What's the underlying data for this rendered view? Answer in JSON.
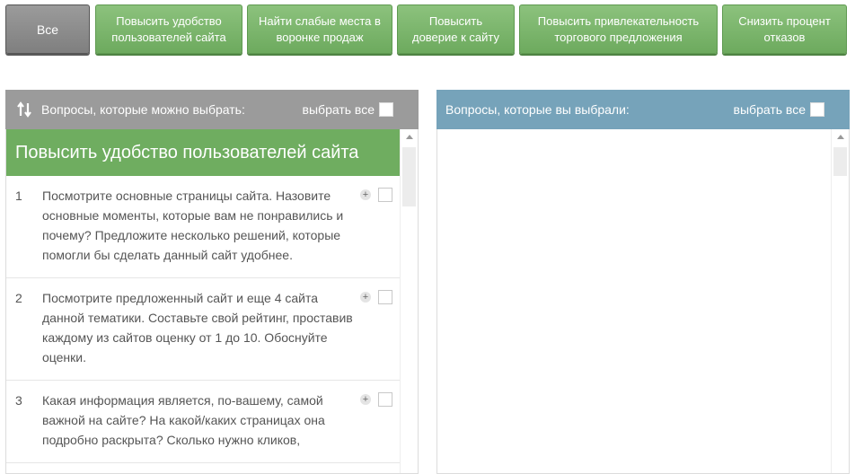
{
  "filters": [
    {
      "label": "Все",
      "active": true
    },
    {
      "label": "Повысить удобство пользователей сайта",
      "active": false
    },
    {
      "label": "Найти слабые места в воронке продаж",
      "active": false
    },
    {
      "label": "Повысить доверие к сайту",
      "active": false
    },
    {
      "label": "Повысить привлекательность торгового предложения",
      "active": false
    },
    {
      "label": "Снизить процент отказов",
      "active": false
    }
  ],
  "left_panel": {
    "title": "Вопросы, которые можно выбрать:",
    "select_all": "выбрать все",
    "group_title": "Повысить удобство пользователей сайта",
    "questions": [
      {
        "num": "1",
        "text": "Посмотрите основные страницы сайта. Назовите основные моменты, которые вам не понравились и почему? Предложите несколько решений, которые помогли бы сделать данный сайт удобнее."
      },
      {
        "num": "2",
        "text": "Посмотрите предложенный сайт и еще 4 сайта данной тематики. Составьте свой рейтинг, проставив каждому из сайтов оценку от 1 до 10. Обоснуйте оценки."
      },
      {
        "num": "3",
        "text": "Какая информация является, по-вашему, самой важной на сайте? На какой/каких страницах она подробно раскрыта? Сколько нужно кликов,"
      }
    ],
    "plus_symbol": "+"
  },
  "right_panel": {
    "title": "Вопросы, которые вы выбрали:",
    "select_all": "выбрать все"
  },
  "colors": {
    "green": "#6fad60",
    "gray_header": "#9b9b9b",
    "blue_header": "#76a3ba"
  }
}
